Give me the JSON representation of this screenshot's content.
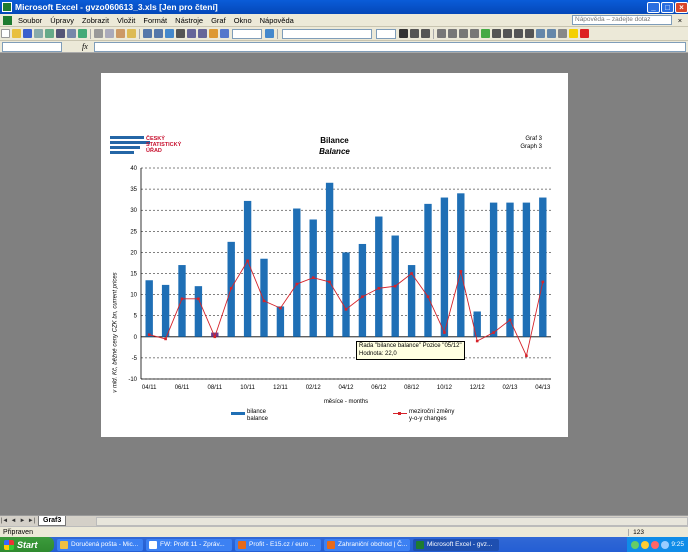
{
  "window": {
    "title": "Microsoft Excel - gvzo060613_3.xls [Jen pro čtení]",
    "minimize": "_",
    "maximize": "□",
    "close": "×"
  },
  "menubar": {
    "items": [
      "Soubor",
      "Úpravy",
      "Zobrazit",
      "Vložit",
      "Formát",
      "Nástroje",
      "Graf",
      "Okno",
      "Nápověda"
    ],
    "help_placeholder": "Nápověda – zadejte dotaz",
    "close": "×"
  },
  "formula_bar": {
    "fx": "fx"
  },
  "chart": {
    "logo": "ČESKÝ STATISTICKÝ ÚŘAD",
    "title": "Bilance",
    "subtitle": "Balance",
    "graf_label_1": "Graf 3",
    "graf_label_2": "Graph 3",
    "ylabel": "v mld. Kč, běžné ceny CZK bn, current prices",
    "xlabel": "měsíce - months",
    "legend_bar_1": "bilance",
    "legend_bar_2": "balance",
    "legend_line_1": "meziroční změny",
    "legend_line_2": "y-o-y changes",
    "tooltip_line1": "Řada \"bilance balance\" Pozice \"05/12\"",
    "tooltip_line2": "Hodnota: 22,0",
    "colors": {
      "bar": "#1f6fb5",
      "line": "#d5232a",
      "highlight_bar": "#6b3a8f"
    }
  },
  "chart_data": {
    "type": "bar",
    "categories": [
      "04/11",
      "05/11",
      "06/11",
      "07/11",
      "08/11",
      "09/11",
      "10/11",
      "11/11",
      "12/11",
      "01/12",
      "02/12",
      "03/12",
      "04/12",
      "05/12",
      "06/12",
      "07/12",
      "08/12",
      "09/12",
      "10/12",
      "11/12",
      "12/12",
      "01/13",
      "02/13",
      "03/13",
      "04/13"
    ],
    "xtick_labels": [
      "04/11",
      "06/11",
      "08/11",
      "10/11",
      "12/11",
      "02/12",
      "04/12",
      "06/12",
      "08/12",
      "10/12",
      "12/12",
      "02/13",
      "04/13"
    ],
    "series": [
      {
        "name": "bilance balance",
        "type": "bar",
        "values": [
          13.4,
          12.3,
          17.0,
          12.0,
          1.0,
          22.5,
          32.2,
          18.5,
          7.2,
          30.4,
          27.8,
          36.5,
          20.0,
          22.0,
          28.5,
          24.0,
          17.0,
          31.5,
          33.0,
          34.0,
          6.0,
          31.8,
          31.8,
          31.8,
          33.0
        ]
      },
      {
        "name": "meziroční změny y-o-y changes",
        "type": "line",
        "values": [
          0.5,
          -0.5,
          9.0,
          9.0,
          0.0,
          11.5,
          18.0,
          8.5,
          6.8,
          12.5,
          14.0,
          13.0,
          6.5,
          9.5,
          11.5,
          12.0,
          15.0,
          9.5,
          1.0,
          15.5,
          -1.0,
          1.0,
          4.0,
          -4.5,
          13.0
        ]
      }
    ],
    "yticks": [
      40,
      35,
      30,
      25,
      20,
      15,
      10,
      5,
      0,
      -5,
      -10
    ],
    "ylim": [
      -10,
      40
    ],
    "xlabel": "měsíce - months",
    "ylabel": "v mld. Kč, běžné ceny CZK bn, current prices",
    "title": "Bilance",
    "grid": true,
    "legend_position": "bottom"
  },
  "sheet_tabs": {
    "active": "Graf3"
  },
  "statusbar": {
    "text": "Připraven",
    "num": "123"
  },
  "taskbar": {
    "start": "Start",
    "items": [
      "Doručená pošta - Mic...",
      "FW: Profit 11 - Zpráv...",
      "Profit - E15.cz / euro ...",
      "Zahraniční obchod | Č...",
      "Microsoft Excel - gvz..."
    ],
    "clock": "9:25"
  }
}
